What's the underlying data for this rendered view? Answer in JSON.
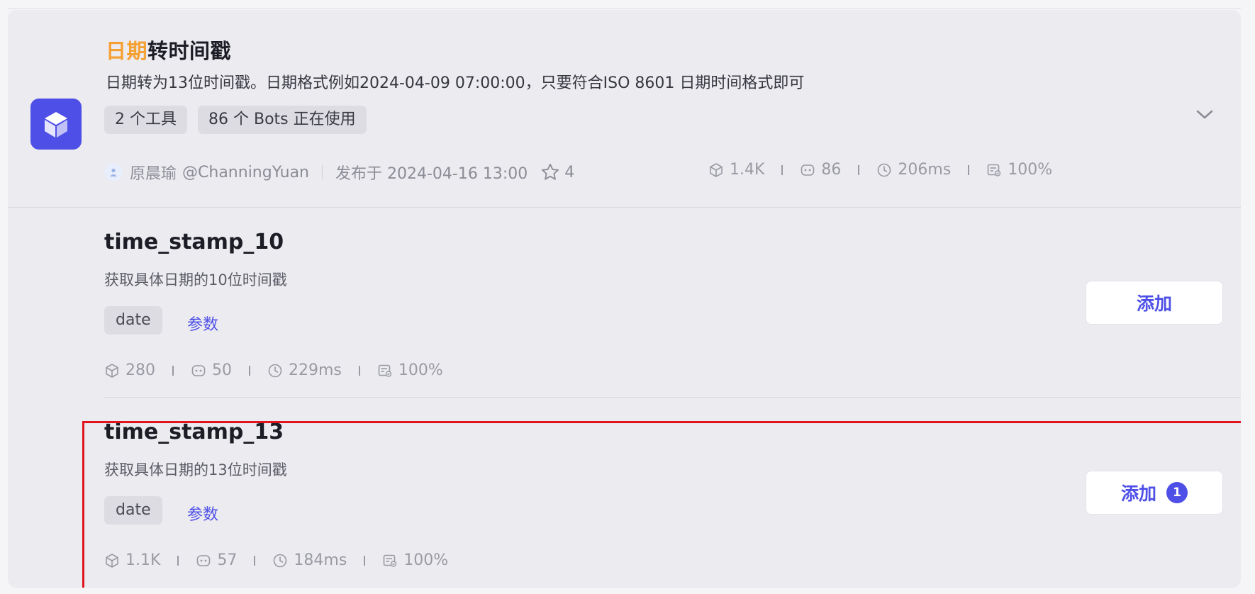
{
  "plugin": {
    "title_highlight": "日期",
    "title_rest": "转时间戳",
    "description": "日期转为13位时间戳。日期格式例如2024-04-09 07:00:00，只要符合ISO 8601 日期时间格式即可",
    "chips": [
      "2 个工具",
      "86 个 Bots 正在使用"
    ],
    "author": "原晨瑜",
    "handle": "@ChanningYuan",
    "published": "发布于 2024-04-16 13:00",
    "favorites": "4",
    "stats": {
      "calls": "1.4K",
      "bots": "86",
      "latency": "206ms",
      "success": "100%"
    },
    "icon": "cube-icon",
    "accent_color": "#f5a033",
    "brand_color": "#4e4fe6"
  },
  "tools": [
    {
      "name": "time_stamp_10",
      "description": "获取具体日期的10位时间戳",
      "tag": "date",
      "param_label": "参数",
      "stats": {
        "calls": "280",
        "bots": "50",
        "latency": "229ms",
        "success": "100%"
      },
      "add_label": "添加",
      "badge": ""
    },
    {
      "name": "time_stamp_13",
      "description": "获取具体日期的13位时间戳",
      "tag": "date",
      "param_label": "参数",
      "stats": {
        "calls": "1.1K",
        "bots": "57",
        "latency": "184ms",
        "success": "100%"
      },
      "add_label": "添加",
      "badge": "1"
    }
  ]
}
